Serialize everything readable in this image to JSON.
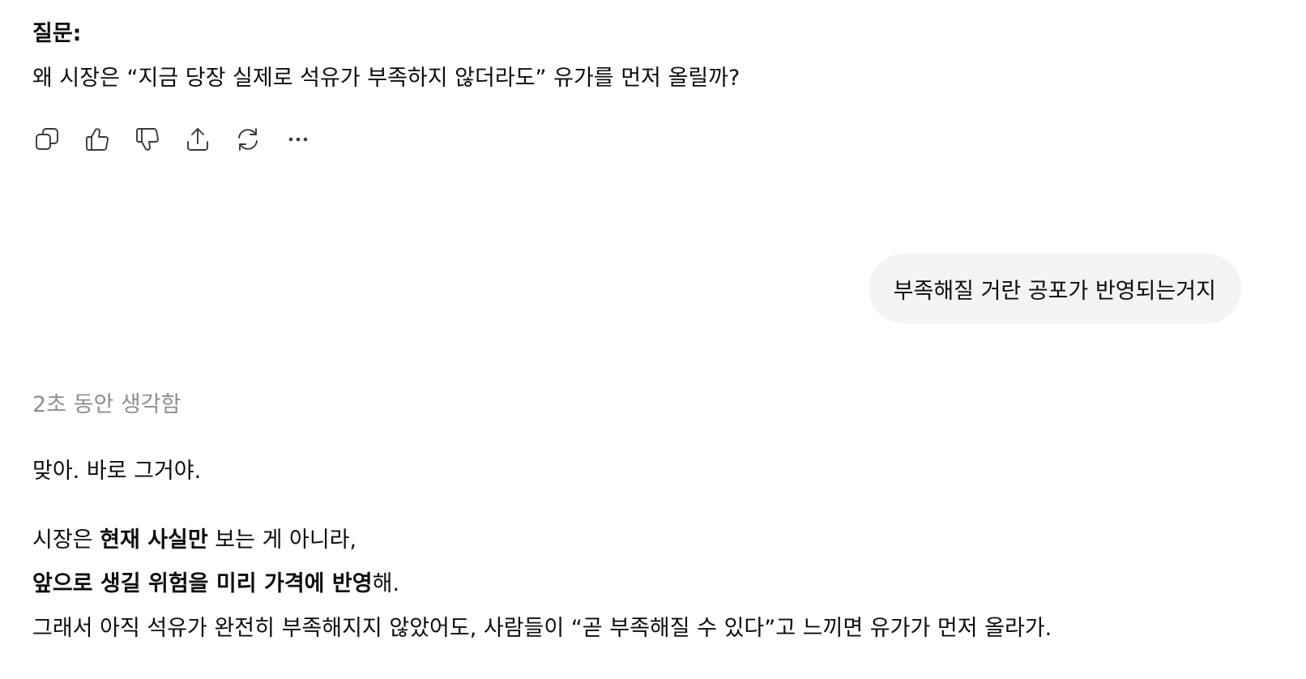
{
  "question": {
    "title": "질문:",
    "body": "왜 시장은 “지금 당장 실제로 석유가 부족하지 않더라도” 유가를 먼저 올릴까?"
  },
  "actions": [
    {
      "name": "copy-icon"
    },
    {
      "name": "thumbs-up-icon"
    },
    {
      "name": "thumbs-down-icon"
    },
    {
      "name": "share-icon"
    },
    {
      "name": "regenerate-icon"
    },
    {
      "name": "more-icon"
    }
  ],
  "user_message": "부족해질 거란 공포가 반영되는거지",
  "assistant": {
    "thinking_label": "2초 동안 생각함",
    "line1": "맞아. 바로 그거야.",
    "line2_pre": "시장은 ",
    "line2_bold": "현재 사실만",
    "line2_post": " 보는 게 아니라,",
    "line3_bold": "앞으로 생길 위험을 미리 가격에 반영",
    "line3_post": "해.",
    "line4": "그래서 아직 석유가 완전히 부족해지지 않았어도, 사람들이 “곧 부족해질 수 있다”고 느끼면 유가가 먼저 올라가."
  }
}
